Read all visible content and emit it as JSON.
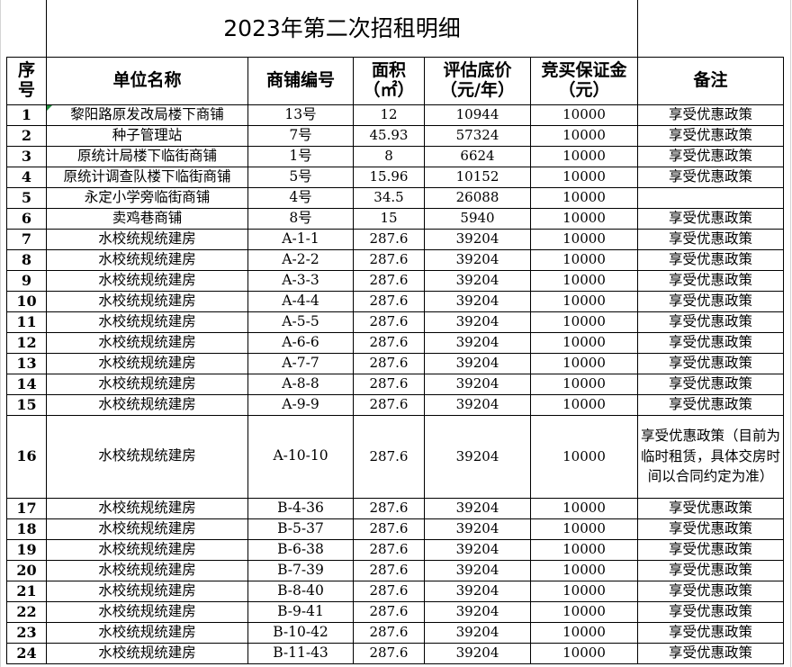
{
  "title": "2023年第二次招租明细",
  "headers": {
    "seq": "序号",
    "unit": "单位名称",
    "shop_no": "商铺编号",
    "area": "面积（㎡）",
    "price": "评估底价（元/年）",
    "deposit": "竞买保证金（元）",
    "note": "备注"
  },
  "rows": [
    {
      "seq": "1",
      "unit": "黎阳路原发改局楼下商铺",
      "shop_no": "13号",
      "area": "12",
      "price": "10944",
      "deposit": "10000",
      "note": "享受优惠政策"
    },
    {
      "seq": "2",
      "unit": "种子管理站",
      "shop_no": "7号",
      "area": "45.93",
      "price": "57324",
      "deposit": "10000",
      "note": "享受优惠政策"
    },
    {
      "seq": "3",
      "unit": "原统计局楼下临街商铺",
      "shop_no": "1号",
      "area": "8",
      "price": "6624",
      "deposit": "10000",
      "note": "享受优惠政策"
    },
    {
      "seq": "4",
      "unit": "原统计调查队楼下临街商铺",
      "shop_no": "5号",
      "area": "15.96",
      "price": "10152",
      "deposit": "10000",
      "note": "享受优惠政策"
    },
    {
      "seq": "5",
      "unit": "永定小学旁临街商铺",
      "shop_no": "4号",
      "area": "34.5",
      "price": "26088",
      "deposit": "10000",
      "note": ""
    },
    {
      "seq": "6",
      "unit": "卖鸡巷商铺",
      "shop_no": "8号",
      "area": "15",
      "price": "5940",
      "deposit": "10000",
      "note": "享受优惠政策"
    },
    {
      "seq": "7",
      "unit": "水校统规统建房",
      "shop_no": "A-1-1",
      "area": "287.6",
      "price": "39204",
      "deposit": "10000",
      "note": "享受优惠政策"
    },
    {
      "seq": "8",
      "unit": "水校统规统建房",
      "shop_no": "A-2-2",
      "area": "287.6",
      "price": "39204",
      "deposit": "10000",
      "note": "享受优惠政策"
    },
    {
      "seq": "9",
      "unit": "水校统规统建房",
      "shop_no": "A-3-3",
      "area": "287.6",
      "price": "39204",
      "deposit": "10000",
      "note": "享受优惠政策"
    },
    {
      "seq": "10",
      "unit": "水校统规统建房",
      "shop_no": "A-4-4",
      "area": "287.6",
      "price": "39204",
      "deposit": "10000",
      "note": "享受优惠政策"
    },
    {
      "seq": "11",
      "unit": "水校统规统建房",
      "shop_no": "A-5-5",
      "area": "287.6",
      "price": "39204",
      "deposit": "10000",
      "note": "享受优惠政策"
    },
    {
      "seq": "12",
      "unit": "水校统规统建房",
      "shop_no": "A-6-6",
      "area": "287.6",
      "price": "39204",
      "deposit": "10000",
      "note": "享受优惠政策"
    },
    {
      "seq": "13",
      "unit": "水校统规统建房",
      "shop_no": "A-7-7",
      "area": "287.6",
      "price": "39204",
      "deposit": "10000",
      "note": "享受优惠政策"
    },
    {
      "seq": "14",
      "unit": "水校统规统建房",
      "shop_no": "A-8-8",
      "area": "287.6",
      "price": "39204",
      "deposit": "10000",
      "note": "享受优惠政策"
    },
    {
      "seq": "15",
      "unit": "水校统规统建房",
      "shop_no": "A-9-9",
      "area": "287.6",
      "price": "39204",
      "deposit": "10000",
      "note": "享受优惠政策"
    },
    {
      "seq": "16",
      "unit": "水校统规统建房",
      "shop_no": "A-10-10",
      "area": "287.6",
      "price": "39204",
      "deposit": "10000",
      "note": "享受优惠政策（目前为临时租赁，具体交房时间以合同约定为准）"
    },
    {
      "seq": "17",
      "unit": "水校统规统建房",
      "shop_no": "B-4-36",
      "area": "287.6",
      "price": "39204",
      "deposit": "10000",
      "note": "享受优惠政策"
    },
    {
      "seq": "18",
      "unit": "水校统规统建房",
      "shop_no": "B-5-37",
      "area": "287.6",
      "price": "39204",
      "deposit": "10000",
      "note": "享受优惠政策"
    },
    {
      "seq": "19",
      "unit": "水校统规统建房",
      "shop_no": "B-6-38",
      "area": "287.6",
      "price": "39204",
      "deposit": "10000",
      "note": "享受优惠政策"
    },
    {
      "seq": "20",
      "unit": "水校统规统建房",
      "shop_no": "B-7-39",
      "area": "287.6",
      "price": "39204",
      "deposit": "10000",
      "note": "享受优惠政策"
    },
    {
      "seq": "21",
      "unit": "水校统规统建房",
      "shop_no": "B-8-40",
      "area": "287.6",
      "price": "39204",
      "deposit": "10000",
      "note": "享受优惠政策"
    },
    {
      "seq": "22",
      "unit": "水校统规统建房",
      "shop_no": "B-9-41",
      "area": "287.6",
      "price": "39204",
      "deposit": "10000",
      "note": "享受优惠政策"
    },
    {
      "seq": "23",
      "unit": "水校统规统建房",
      "shop_no": "B-10-42",
      "area": "287.6",
      "price": "39204",
      "deposit": "10000",
      "note": "享受优惠政策"
    },
    {
      "seq": "24",
      "unit": "水校统规统建房",
      "shop_no": "B-11-43",
      "area": "287.6",
      "price": "39204",
      "deposit": "10000",
      "note": "享受优惠政策"
    }
  ]
}
